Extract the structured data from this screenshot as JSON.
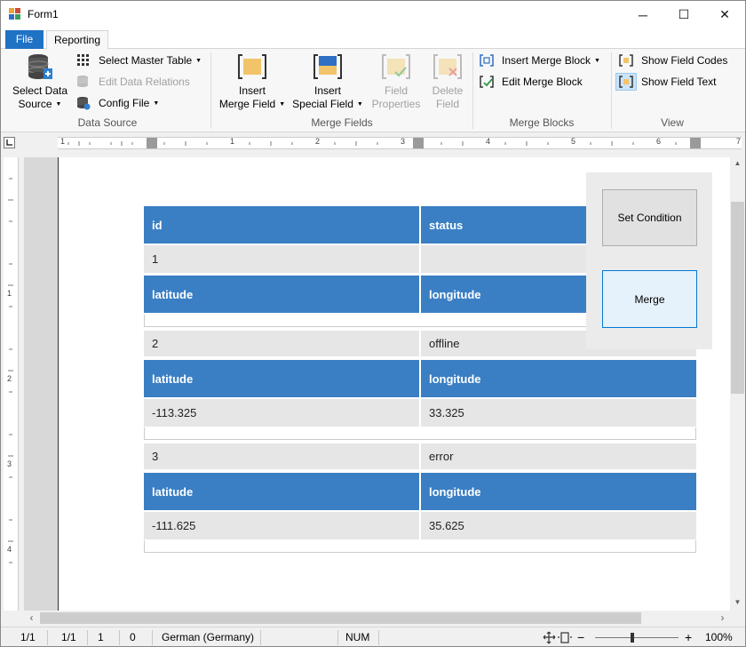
{
  "window": {
    "title": "Form1",
    "min_glyph": "─",
    "max_glyph": "☐",
    "close_glyph": "✕"
  },
  "ribbon": {
    "tabs": [
      {
        "label": "File",
        "active": false,
        "color": "#1f72c4"
      },
      {
        "label": "Reporting",
        "active": true
      }
    ],
    "groups": {
      "data_source": {
        "label": "Data Source",
        "select_data_source": {
          "line1": "Select Data",
          "line2": "Source"
        },
        "select_master_table": "Select Master Table",
        "edit_data_relations": "Edit Data Relations",
        "config_file": "Config File"
      },
      "merge_fields": {
        "label": "Merge Fields",
        "insert_merge_field": {
          "line1": "Insert",
          "line2": "Merge Field"
        },
        "insert_special_field": {
          "line1": "Insert",
          "line2": "Special Field"
        },
        "field_properties": {
          "line1": "Field",
          "line2": "Properties"
        },
        "delete_field": {
          "line1": "Delete",
          "line2": "Field"
        }
      },
      "merge_blocks": {
        "label": "Merge Blocks",
        "insert_merge_block": "Insert Merge Block",
        "edit_merge_block": "Edit Merge Block"
      },
      "view": {
        "label": "View",
        "show_field_codes": "Show Field Codes",
        "show_field_text": "Show Field Text"
      }
    }
  },
  "ruler": {
    "h_numbers": [
      "1",
      "1",
      "2",
      "3",
      "4",
      "5",
      "6",
      "7"
    ],
    "v_numbers": [
      "1",
      "2",
      "3",
      "4"
    ]
  },
  "document": {
    "header_color": "#3a7fc4",
    "value_color": "#e6e6e6",
    "top_header": {
      "col1": "id",
      "col2": "status"
    },
    "records": [
      {
        "id": "1",
        "status": "",
        "latitude": "",
        "longitude": ""
      },
      {
        "id": "2",
        "status": "offline",
        "latitude": "-113.325",
        "longitude": "33.325"
      },
      {
        "id": "3",
        "status": "error",
        "latitude": "-111.625",
        "longitude": "35.625"
      }
    ],
    "sub_header": {
      "col1": "latitude",
      "col2": "longitude"
    }
  },
  "panel": {
    "set_condition": "Set Condition",
    "merge": "Merge"
  },
  "statusbar": {
    "section": "1/1",
    "page": "1/1",
    "line": "1",
    "column": "0",
    "language": "German (Germany)",
    "num": "NUM",
    "zoom": "100%",
    "zoom_fraction": 0.45
  }
}
